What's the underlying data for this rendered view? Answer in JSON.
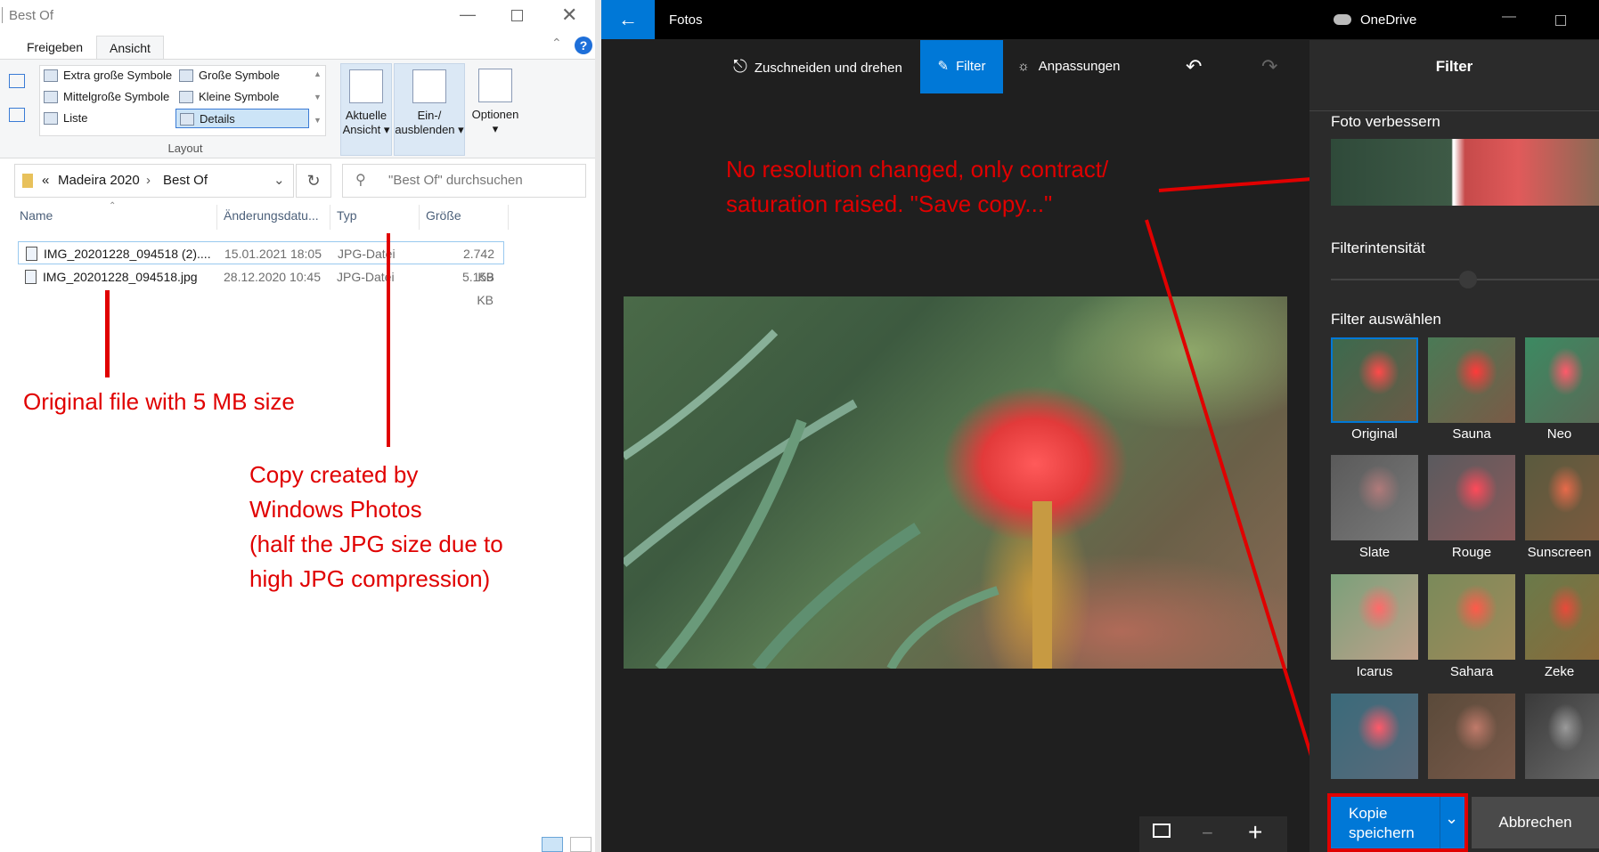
{
  "explorer": {
    "title": "Best Of",
    "tabs": [
      "Freigeben",
      "Ansicht"
    ],
    "layout_items": [
      "Extra große Symbole",
      "Große Symbole",
      "Mittelgroße Symbole",
      "Kleine Symbole",
      "Liste",
      "Details"
    ],
    "layout_group_label": "Layout",
    "current_view_label": [
      "Aktuelle",
      "Ansicht"
    ],
    "show_hide_label": [
      "Ein-/",
      "ausblenden"
    ],
    "options_label": "Optionen",
    "breadcrumb": [
      "Madeira 2020",
      "Best Of"
    ],
    "breadcrumb_prefix": "«",
    "search_placeholder": "\"Best Of\" durchsuchen",
    "columns": [
      "Name",
      "Änderungsdatu...",
      "Typ",
      "Größe"
    ],
    "files": [
      {
        "name": "IMG_20201228_094518 (2)....",
        "date": "15.01.2021 18:05",
        "type": "JPG-Datei",
        "size": "2.742 KB"
      },
      {
        "name": "IMG_20201228_094518.jpg",
        "date": "28.12.2020 10:45",
        "type": "JPG-Datei",
        "size": "5.159 KB"
      }
    ]
  },
  "annotations": {
    "original": "Original file with 5 MB size",
    "copy": [
      "Copy created by",
      "Windows Photos",
      "(half the JPG size due to",
      "high JPG compression)"
    ],
    "resolution": [
      "No resolution changed, only contract/",
      "saturation raised. \"Save copy...\""
    ]
  },
  "photos": {
    "app_title": "Fotos",
    "onedrive_label": "OneDrive",
    "tools": [
      "Zuschneiden und drehen",
      "Filter",
      "Anpassungen"
    ],
    "panel_title": "Filter",
    "enhance_label": "Foto verbessern",
    "intensity_label": "Filterintensität",
    "select_label": "Filter auswählen",
    "filters": [
      "Original",
      "Sauna",
      "Neo",
      "Slate",
      "Rouge",
      "Sunscreen",
      "Icarus",
      "Sahara",
      "Zeke",
      "",
      "",
      ""
    ],
    "save_button": [
      "Kopie",
      "speichern"
    ],
    "cancel_button": "Abbrechen",
    "accent": "#0078d7"
  }
}
